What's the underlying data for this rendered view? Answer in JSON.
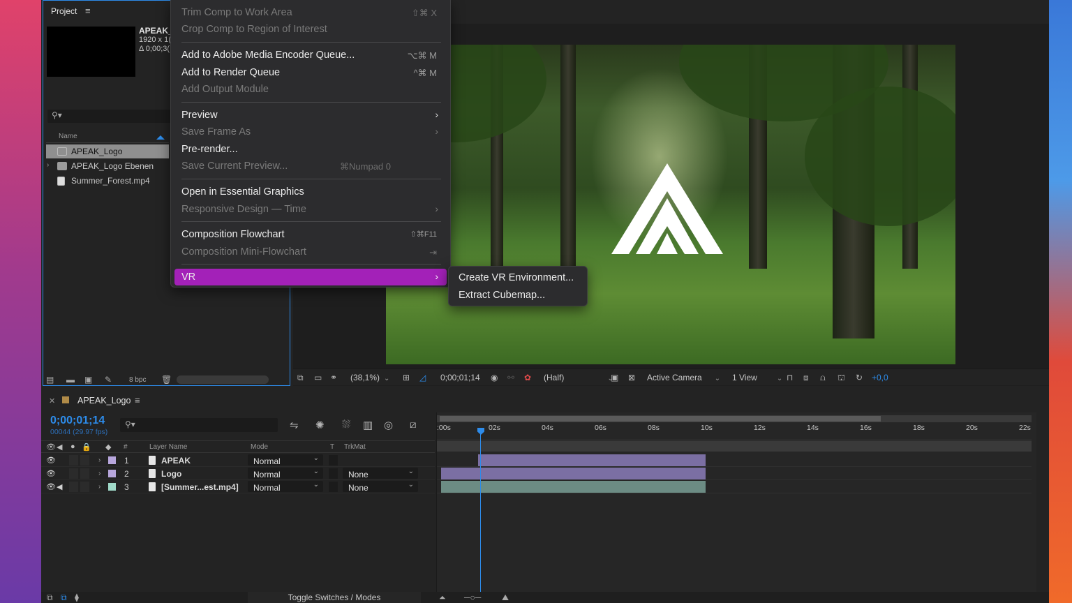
{
  "project": {
    "title": "Project",
    "comp_name": "APEAK_",
    "comp_res": "1920 x 1(",
    "comp_dur": "Δ 0;00;3(",
    "column_name": "Name",
    "items": [
      {
        "label": "APEAK_Logo",
        "selected": true
      },
      {
        "label": "APEAK_Logo Ebenen"
      },
      {
        "label": "Summer_Forest.mp4"
      }
    ],
    "bpc": "8 bpc"
  },
  "menu": {
    "items": [
      {
        "label": "Trim Comp to Work Area",
        "shortcut": "⇧⌘ X",
        "disabled": true
      },
      {
        "label": "Crop Comp to Region of Interest",
        "disabled": true
      },
      {
        "label": "Add to Adobe Media Encoder Queue...",
        "shortcut": "⌥⌘ M"
      },
      {
        "label": "Add to Render Queue",
        "shortcut": "^⌘ M"
      },
      {
        "label": "Add Output Module",
        "disabled": true
      },
      {
        "label": "Preview",
        "submenu": true
      },
      {
        "label": "Save Frame As",
        "submenu": true,
        "disabled": true
      },
      {
        "label": "Pre-render..."
      },
      {
        "label": "Save Current Preview...",
        "shortcut": "⌘Numpad 0",
        "disabled": true
      },
      {
        "label": "Open in Essential Graphics"
      },
      {
        "label": "Responsive Design — Time",
        "submenu": true,
        "disabled": true
      },
      {
        "label": "Composition Flowchart",
        "shortcut": "⇧⌘F11"
      },
      {
        "label": "Composition Mini-Flowchart",
        "shortcut": "⇥",
        "disabled": true
      },
      {
        "label": "VR",
        "submenu": true,
        "active": true
      }
    ],
    "vr_submenu": [
      "Create VR Environment...",
      "Extract Cubemap..."
    ]
  },
  "viewer": {
    "zoom": "(38,1%)",
    "timecode": "0;00;01;14",
    "resolution": "(Half)",
    "camera": "Active Camera",
    "views": "1 View",
    "exposure": "+0,0"
  },
  "timeline": {
    "comp_tab": "APEAK_Logo",
    "timecode": "0;00;01;14",
    "frames": "00044 (29.97 fps)",
    "columns": {
      "num": "#",
      "layer_name": "Layer Name",
      "mode": "Mode",
      "t": "T",
      "trkmat": "TrkMat"
    },
    "ruler": [
      ":00s",
      "02s",
      "04s",
      "06s",
      "08s",
      "10s",
      "12s",
      "14s",
      "16s",
      "18s",
      "20s",
      "22s"
    ],
    "layers": [
      {
        "num": "1",
        "name": "APEAK",
        "mode": "Normal",
        "trkmat": "",
        "color": "#b7a6dc"
      },
      {
        "num": "2",
        "name": "Logo",
        "mode": "Normal",
        "trkmat": "None",
        "color": "#b7a6dc"
      },
      {
        "num": "3",
        "name": "[Summer...est.mp4]",
        "mode": "Normal",
        "trkmat": "None",
        "color": "#9fd9c8"
      }
    ],
    "footer_toggle": "Toggle Switches / Modes"
  },
  "colors": {
    "accent": "#2d8ceb",
    "menu_highlight": "#a321b8"
  }
}
